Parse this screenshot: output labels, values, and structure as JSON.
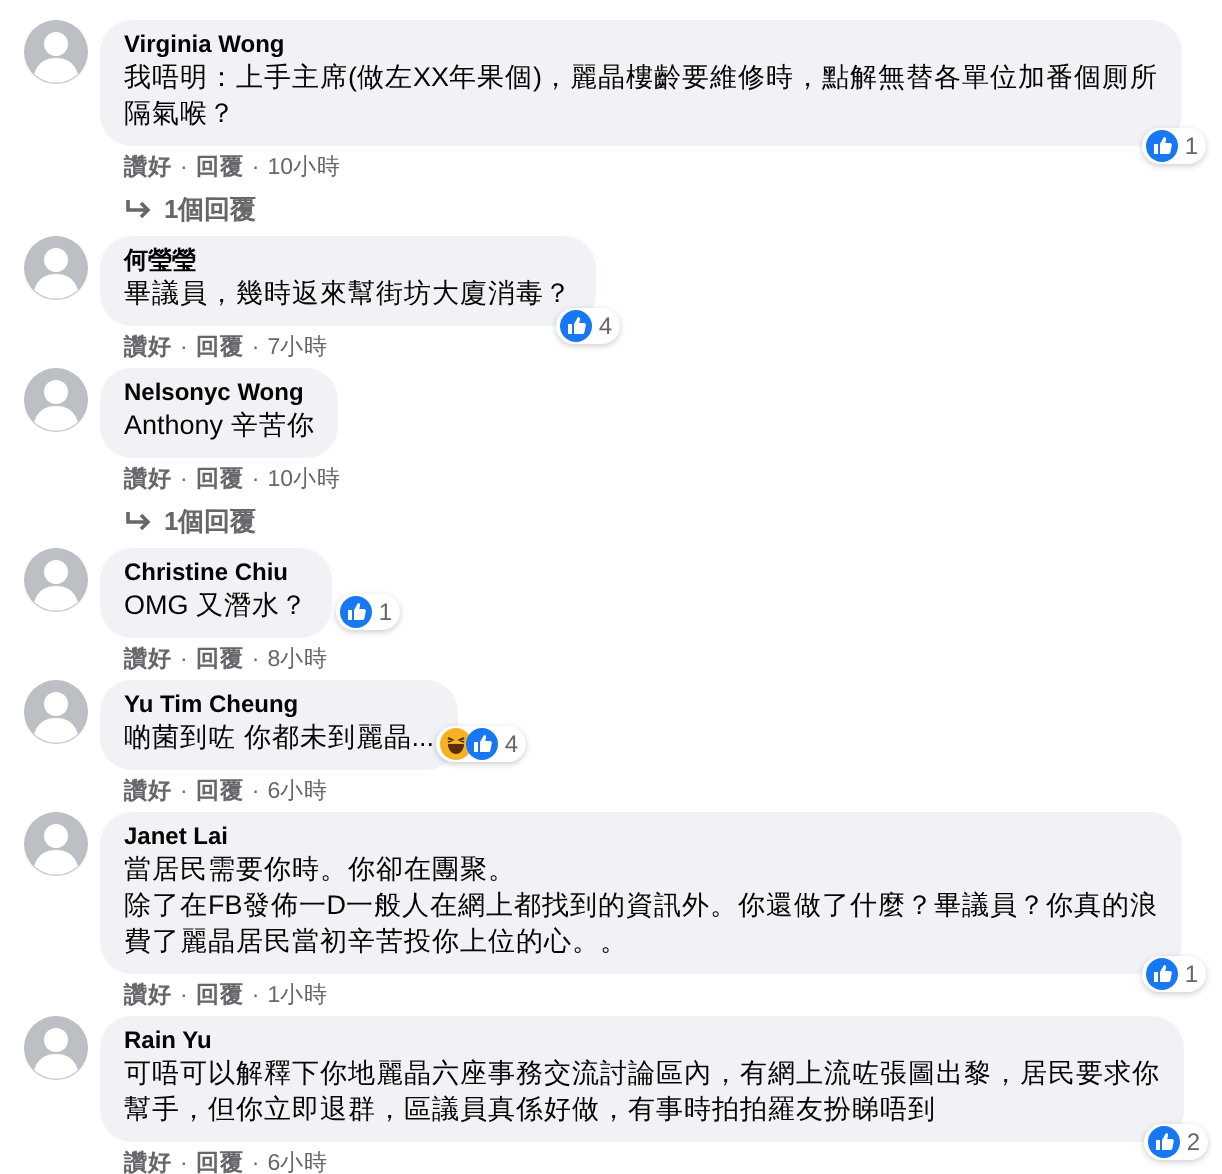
{
  "comments": [
    {
      "name": "Virginia Wong",
      "lines": [
        "我唔明：上手主席(做左XX年果個)，麗晶樓齡要維修時，點解無替各單位加番個厠所",
        "隔氣喉？"
      ],
      "reactions": [
        {
          "kind": "like"
        }
      ],
      "reaction_count": "1",
      "actions": [
        "讚好",
        "·",
        "回覆",
        "·",
        "10小時"
      ],
      "replies": "1個回覆"
    },
    {
      "name": "何瑩瑩",
      "lines": [
        "畢議員，幾時返來幫街坊大廈消毒？"
      ],
      "reactions": [
        {
          "kind": "like"
        }
      ],
      "reaction_count": "4",
      "actions": [
        "讚好",
        "·",
        "回覆",
        "·",
        "7小時"
      ]
    },
    {
      "name": "Nelsonyc Wong",
      "lines": [
        "Anthony 辛苦你"
      ],
      "actions": [
        "讚好",
        "·",
        "回覆",
        "·",
        "10小時"
      ],
      "replies": "1個回覆"
    },
    {
      "name": "Christine Chiu",
      "lines": [
        "OMG 又潛水？"
      ],
      "reactions": [
        {
          "kind": "like"
        }
      ],
      "reaction_count": "1",
      "actions": [
        "讚好",
        "·",
        "回覆",
        "·",
        "8小時"
      ]
    },
    {
      "name": "Yu Tim Cheung",
      "lines": [
        "啲菌到咗 你都未到麗晶..."
      ],
      "reactions": [
        {
          "kind": "haha"
        },
        {
          "kind": "like"
        }
      ],
      "reaction_count": "4",
      "actions": [
        "讚好",
        "·",
        "回覆",
        "·",
        "6小時"
      ]
    },
    {
      "name": "Janet Lai",
      "lines": [
        "當居民需要你時。你卻在團聚。",
        "除了在FB發佈一D一般人在網上都找到的資訊外。你還做了什麼？畢議員？你真的浪",
        "費了麗晶居民當初辛苦投你上位的心。。"
      ],
      "reactions": [
        {
          "kind": "like"
        }
      ],
      "reaction_count": "1",
      "actions": [
        "讚好",
        "·",
        "回覆",
        "·",
        "1小時"
      ]
    },
    {
      "name": "Rain Yu",
      "lines": [
        "可唔可以解釋下你地麗晶六座事務交流討論區內，有網上流咗張圖出黎，居民要求你",
        "幫手，但你立即退群，區議員真係好做，有事時拍拍羅友扮睇唔到"
      ],
      "reactions": [
        {
          "kind": "like"
        }
      ],
      "reaction_count": "2",
      "actions": [
        "讚好",
        "·",
        "回覆",
        "·",
        "6小時"
      ]
    }
  ]
}
